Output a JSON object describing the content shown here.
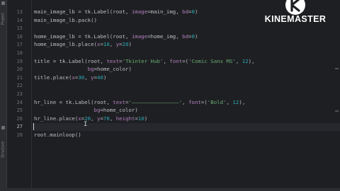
{
  "side_panel": {
    "tabs": [
      {
        "label": "Project",
        "icon": "folder-icon"
      },
      {
        "label": "Structure",
        "icon": "structure-icon"
      }
    ]
  },
  "editor": {
    "current_line": 27,
    "lines": [
      {
        "num": "13",
        "segments": [
          [
            "main_image_lb = tk.Label(root, ",
            "p"
          ],
          [
            "image",
            "param"
          ],
          [
            "=main_img, ",
            "p"
          ],
          [
            "bd",
            "param"
          ],
          [
            "=",
            "p"
          ],
          [
            "0",
            "num"
          ],
          [
            ")",
            "p"
          ]
        ]
      },
      {
        "num": "14",
        "segments": [
          [
            "main_image_lb.pack()",
            "p"
          ]
        ]
      },
      {
        "num": "15",
        "segments": []
      },
      {
        "num": "16",
        "segments": [
          [
            "home_image_lb = tk.Label(root, ",
            "p"
          ],
          [
            "image",
            "param"
          ],
          [
            "=home_img, ",
            "p"
          ],
          [
            "bd",
            "param"
          ],
          [
            "=",
            "p"
          ],
          [
            "0",
            "num"
          ],
          [
            ")",
            "p"
          ]
        ]
      },
      {
        "num": "17",
        "segments": [
          [
            "home_image_lb.place(",
            "p"
          ],
          [
            "x",
            "param"
          ],
          [
            "=",
            "p"
          ],
          [
            "10",
            "num"
          ],
          [
            ", ",
            "p"
          ],
          [
            "y",
            "param"
          ],
          [
            "=",
            "p"
          ],
          [
            "20",
            "num"
          ],
          [
            ")",
            "p"
          ]
        ]
      },
      {
        "num": "18",
        "segments": []
      },
      {
        "num": "19",
        "segments": [
          [
            "title = tk.Label(root, ",
            "p"
          ],
          [
            "text",
            "param"
          ],
          [
            "=",
            "p"
          ],
          [
            "'Tkinter Hub'",
            "str"
          ],
          [
            ", ",
            "p"
          ],
          [
            "font",
            "param"
          ],
          [
            "=(",
            "p"
          ],
          [
            "'Comic Sans MS'",
            "str"
          ],
          [
            ", ",
            "p"
          ],
          [
            "12",
            "num"
          ],
          [
            "),",
            "p"
          ]
        ]
      },
      {
        "num": "20",
        "segments": [
          [
            "                 ",
            "p"
          ],
          [
            "bg",
            "param"
          ],
          [
            "=home_color)",
            "p"
          ]
        ]
      },
      {
        "num": "21",
        "segments": [
          [
            "title.place(",
            "p"
          ],
          [
            "x",
            "param"
          ],
          [
            "=",
            "p"
          ],
          [
            "30",
            "num"
          ],
          [
            ", ",
            "p"
          ],
          [
            "y",
            "param"
          ],
          [
            "=",
            "p"
          ],
          [
            "40",
            "num"
          ],
          [
            ")",
            "p"
          ]
        ]
      },
      {
        "num": "22",
        "segments": []
      },
      {
        "num": "23",
        "segments": []
      },
      {
        "num": "24",
        "segments": [
          [
            "hr_line = tk.Label(root, ",
            "p"
          ],
          [
            "text",
            "param"
          ],
          [
            "=",
            "p"
          ],
          [
            "'———————————————'",
            "str"
          ],
          [
            ", ",
            "p"
          ],
          [
            "font",
            "param"
          ],
          [
            "=(",
            "p"
          ],
          [
            "'Bold'",
            "str"
          ],
          [
            ", ",
            "p"
          ],
          [
            "12",
            "num"
          ],
          [
            "),",
            "p"
          ]
        ]
      },
      {
        "num": "25",
        "segments": [
          [
            "                   ",
            "p"
          ],
          [
            "bg",
            "param"
          ],
          [
            "=home_color)",
            "p"
          ]
        ]
      },
      {
        "num": "26",
        "segments": [
          [
            "hr_line.place(",
            "p"
          ],
          [
            "x",
            "param"
          ],
          [
            "=",
            "p"
          ],
          [
            "20",
            "num"
          ],
          [
            ", ",
            "p"
          ],
          [
            "y",
            "param"
          ],
          [
            "=",
            "p"
          ],
          [
            "70",
            "num"
          ],
          [
            ", ",
            "p"
          ],
          [
            "height",
            "param"
          ],
          [
            "=",
            "p"
          ],
          [
            "10",
            "num"
          ],
          [
            ")",
            "p"
          ]
        ]
      },
      {
        "num": "27",
        "segments": []
      },
      {
        "num": "28",
        "segments": [
          [
            "root.mainloop()",
            "p"
          ]
        ]
      }
    ]
  },
  "watermark": {
    "brand": "KINEMASTER",
    "logo_icon": "kinemaster-logo-icon"
  },
  "colors": {
    "background": "#1e1f22",
    "default_text": "#bcbec4",
    "keyword_param": "#b47ec1",
    "string": "#6aab73",
    "number": "#2aacb8"
  }
}
